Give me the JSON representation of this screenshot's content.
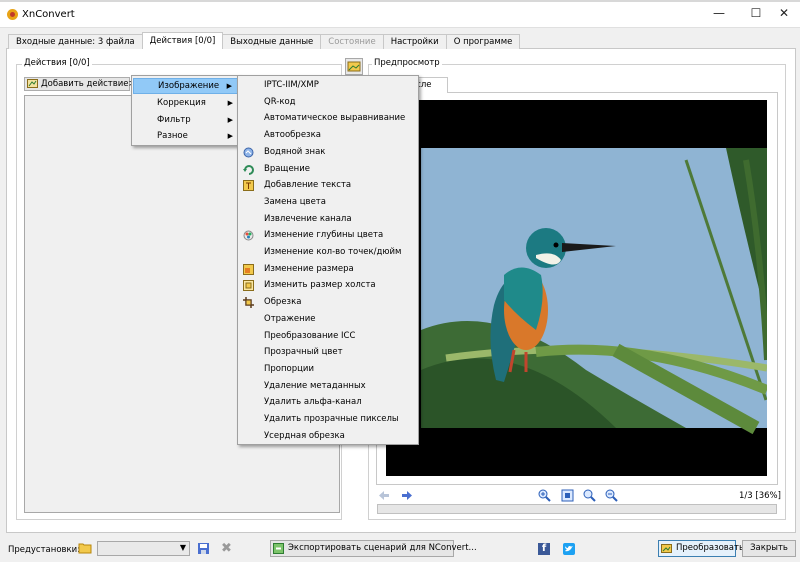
{
  "window": {
    "title": "XnConvert",
    "minimize": "—",
    "maximize": "☐",
    "close": "✕"
  },
  "tabs": [
    {
      "label": "Входные данные: 3 файла",
      "state": "normal"
    },
    {
      "label": "Действия [0/0]",
      "state": "active"
    },
    {
      "label": "Выходные данные",
      "state": "normal"
    },
    {
      "label": "Состояние",
      "state": "disabled"
    },
    {
      "label": "Настройки",
      "state": "normal"
    },
    {
      "label": "О программе",
      "state": "normal"
    }
  ],
  "actions": {
    "group_label": "Действия [0/0]",
    "add_button": "Добавить действие>"
  },
  "preview": {
    "group_label": "Предпросмотр",
    "tab_after": "осле",
    "page_indicator": "1/3 [36%]"
  },
  "menu_categories": [
    {
      "label": "Изображение",
      "highlighted": true
    },
    {
      "label": "Коррекция",
      "highlighted": false
    },
    {
      "label": "Фильтр",
      "highlighted": false
    },
    {
      "label": "Разное",
      "highlighted": false
    }
  ],
  "submenu_image": [
    {
      "label": "IPTC-IIM/XMP",
      "icon": ""
    },
    {
      "label": "QR-код",
      "icon": ""
    },
    {
      "label": "Автоматическое выравнивание",
      "icon": ""
    },
    {
      "label": "Автообрезка",
      "icon": ""
    },
    {
      "label": "Водяной знак",
      "icon": "watermark-icon"
    },
    {
      "label": "Вращение",
      "icon": "rotate-icon"
    },
    {
      "label": "Добавление текста",
      "icon": "text-icon"
    },
    {
      "label": "Замена цвета",
      "icon": ""
    },
    {
      "label": "Извлечение канала",
      "icon": ""
    },
    {
      "label": "Изменение глубины цвета",
      "icon": "color-depth-icon"
    },
    {
      "label": "Изменение кол-во точек/дюйм",
      "icon": ""
    },
    {
      "label": "Изменение размера",
      "icon": "resize-icon"
    },
    {
      "label": "Изменить размер холста",
      "icon": "canvas-icon"
    },
    {
      "label": "Обрезка",
      "icon": "crop-icon"
    },
    {
      "label": "Отражение",
      "icon": ""
    },
    {
      "label": "Преобразование ICC",
      "icon": ""
    },
    {
      "label": "Прозрачный цвет",
      "icon": ""
    },
    {
      "label": "Пропорции",
      "icon": ""
    },
    {
      "label": "Удаление метаданных",
      "icon": ""
    },
    {
      "label": "Удалить альфа-канал",
      "icon": ""
    },
    {
      "label": "Удалить прозрачные пикселы",
      "icon": ""
    },
    {
      "label": "Усердная обрезка",
      "icon": ""
    }
  ],
  "bottom": {
    "presets_label": "Предустановки:",
    "export_button": "Экспортировать сценарий для NConvert...",
    "convert_button": "Преобразовать",
    "close_button": "Закрыть",
    "facebook_glyph": "f"
  },
  "colors": {
    "highlight": "#91c9f7",
    "sky": "#8fb4d3",
    "kingfisher_orange": "#d9782a",
    "kingfisher_teal": "#1f8a8a"
  }
}
